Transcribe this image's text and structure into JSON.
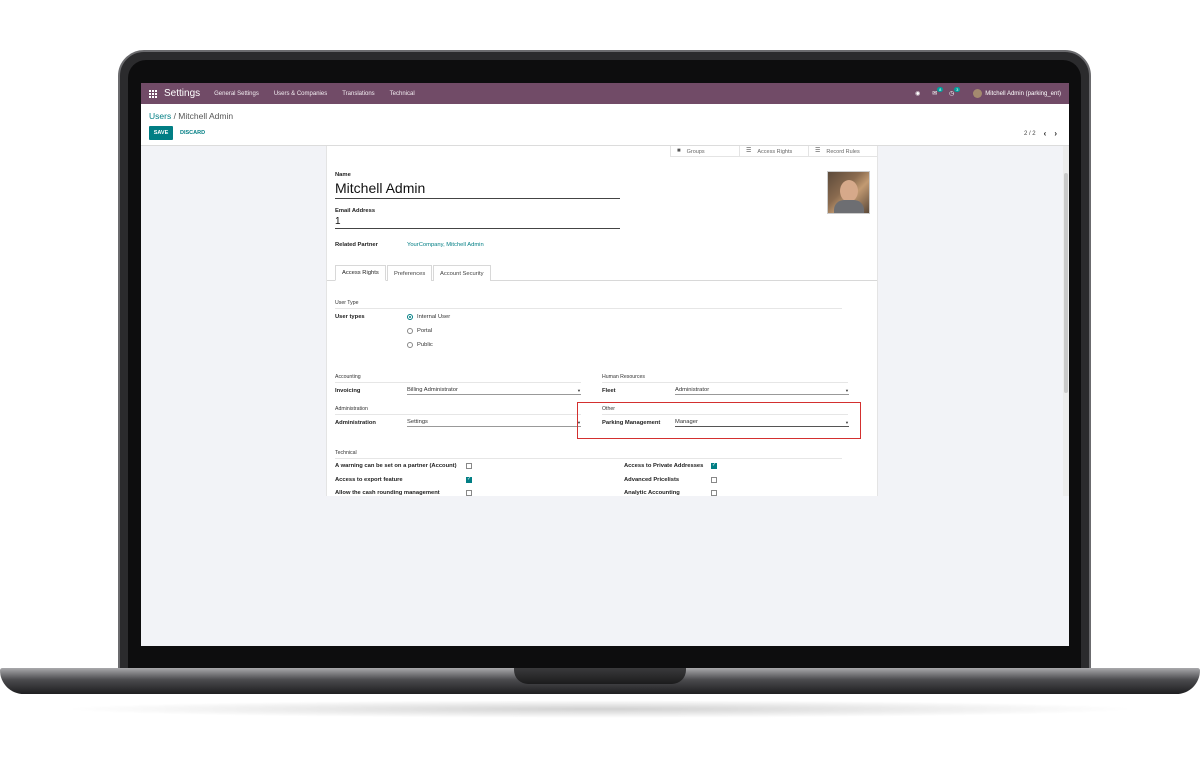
{
  "navbar": {
    "app_title": "Settings",
    "menu": [
      "General Settings",
      "Users & Companies",
      "Translations",
      "Technical"
    ],
    "chat_badge": "8",
    "activity_badge": "3",
    "user_name": "Mitchell Admin (parking_ent)"
  },
  "control": {
    "breadcrumb_parent": "Users",
    "breadcrumb_sep": " / ",
    "breadcrumb_current": "Mitchell Admin",
    "save_label": "SAVE",
    "discard_label": "DISCARD",
    "pager": "2 / 2"
  },
  "stat_buttons": [
    "Groups",
    "Access Rights",
    "Record Rules"
  ],
  "form": {
    "name_label": "Name",
    "name_value": "Mitchell Admin",
    "email_label": "Email Address",
    "email_value": "1",
    "partner_label": "Related Partner",
    "partner_value": "YourCompany, Mitchell Admin"
  },
  "tabs": [
    "Access Rights",
    "Preferences",
    "Account Security"
  ],
  "user_type": {
    "section": "User Type",
    "label": "User types",
    "options": [
      "Internal User",
      "Portal",
      "Public"
    ],
    "selected": "Internal User"
  },
  "groups": {
    "accounting_section": "Accounting",
    "invoicing_label": "Invoicing",
    "invoicing_value": "Billing Administrator",
    "administration_section": "Administration",
    "administration_label": "Administration",
    "administration_value": "Settings",
    "hr_section": "Human Resources",
    "fleet_label": "Fleet",
    "fleet_value": "Administrator",
    "other_section": "Other",
    "parking_label": "Parking Management",
    "parking_value": "Manager"
  },
  "technical": {
    "section": "Technical",
    "left": [
      {
        "label": "A warning can be set on a partner (Account)",
        "checked": false
      },
      {
        "label": "Access to export feature",
        "checked": true
      },
      {
        "label": "Allow the cash rounding management",
        "checked": false
      }
    ],
    "right": [
      {
        "label": "Access to Private Addresses",
        "checked": true
      },
      {
        "label": "Advanced Pricelists",
        "checked": false
      },
      {
        "label": "Analytic Accounting",
        "checked": false
      }
    ]
  },
  "colors": {
    "navbar": "#714b67",
    "accent": "#017e84",
    "highlight": "#d3302f"
  }
}
